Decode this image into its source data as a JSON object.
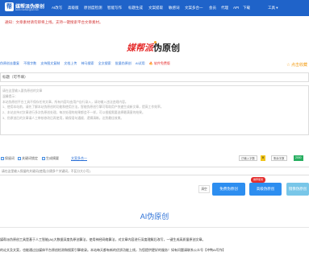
{
  "header": {
    "logo_mark": "帮",
    "logo_title": "媒帮派伪原创",
    "logo_sub": "www.meibangpai.com",
    "nav_items": [
      "AI改写",
      "高级版",
      "原创度检测",
      "智能写作",
      "标题生成",
      "文案提取",
      "敏感词",
      "文案多合一",
      "会员",
      "代理",
      "API",
      "下载"
    ],
    "tools_label": "工具 ▾"
  },
  "notice": "通知：文章素材请勿即将上线，支持一键搜索平台文章素材。",
  "brand": {
    "red": "媒帮派",
    "name": "伪原创"
  },
  "func_bar": {
    "items": [
      "伪原创去重复",
      "不限字数",
      "支持图文复制",
      "文档上传",
      "神马搜索",
      "全文搜索",
      "批量伪原创",
      "AI试用"
    ],
    "red_item": "🔥 软件免费版",
    "fav": "☆ 点击收藏"
  },
  "title_input": {
    "placeholder": "标题（可不填）"
  },
  "content": {
    "lines": [
      "请在这里输入要伪原创的文章",
      "温馨提示：",
      "本站伪原创平台工具不保存任何文章，所有内容均由用户自行录入，请勿输入违法违规内容。",
      "1、使用本站前，请先了解本站伪原创的功能和使用方法，智能伪原创引擎可帮助用户快速生成新文章，提高工作效率。",
      "2、本站支持对文章进行多次伪原创处理，每次处理的结果都会不一样，可以根据需要选择最满意的结果。",
      "3、伪原创后的文章请人工审核修改后再使用，确保语句通顺、逻辑清晰，达到最佳效果。"
    ]
  },
  "options": {
    "keep_label": "保留词",
    "keyword_label": "关键词锁定",
    "generate_label": "生成摘要",
    "link_label": "文案多合一",
    "counter_label": "已输入字数",
    "counter_value": "0",
    "counter_label2": "剩余字数",
    "counter_value2": "2000"
  },
  "keyword_input": {
    "placeholder": "请在这里输入保留的关键词(使用|分隔多个关键词，不区分大小写)"
  },
  "buttons": {
    "clear": "清空",
    "free": "免费伪原创",
    "adv": "高级伪原创",
    "badge": "推荐使用",
    "mirror": "镜像伪原创"
  },
  "section": {
    "title": "AI伪原创",
    "intro_lines": [
      "媒帮派伪原创工具是基于人工智能(AI)大数据深度伪原创算法，使用神经网络算法，对文章内容进行深度理解后改写，一键生成高质量原创文章。",
      "的论文及文案，也能通过自媒体平台原创检测和搜索引擎收录。本站每天都有新的优质功能上线，为您提供更好的服务！如有问题请联系公众号【冲鸭AI写作】"
    ]
  },
  "colors": {
    "nav_bg": "#1f63c9",
    "accent": "#2d8ef0",
    "red": "#e52d2d"
  }
}
